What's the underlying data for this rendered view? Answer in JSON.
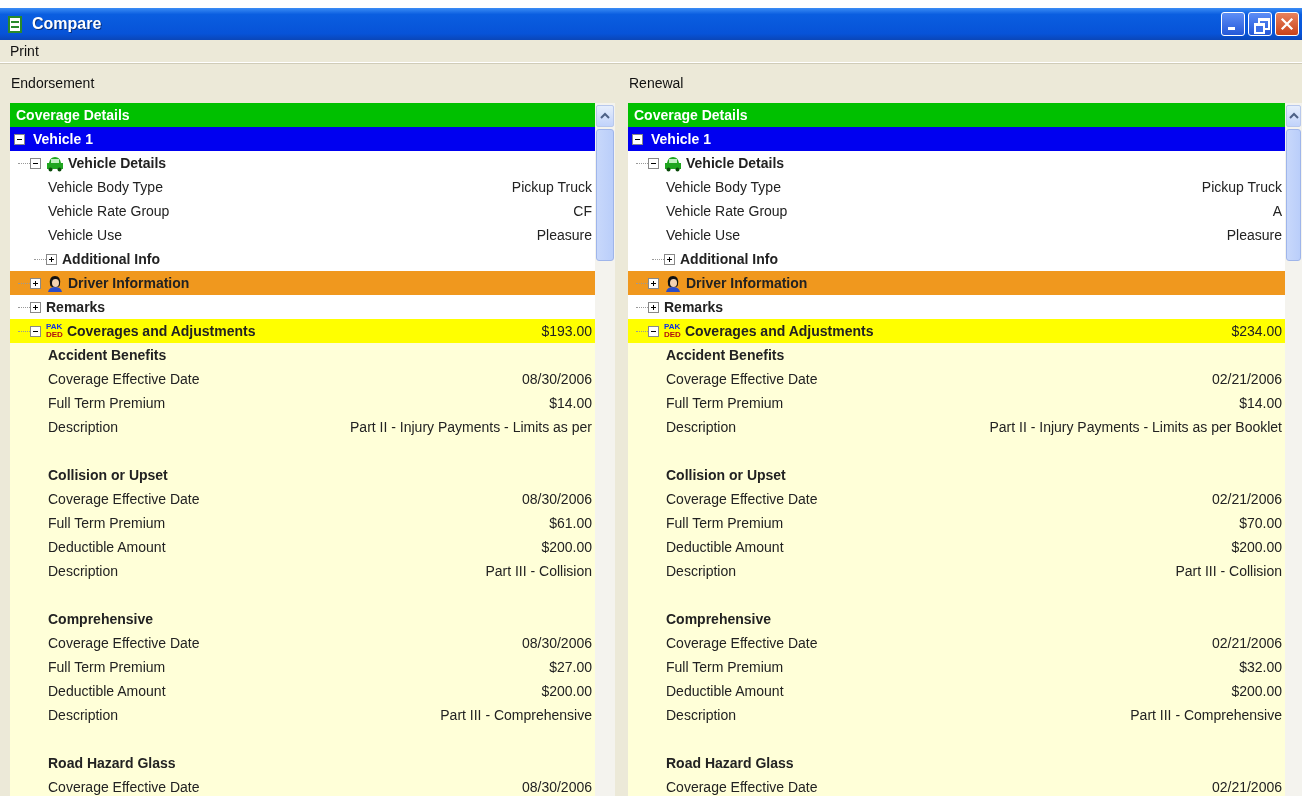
{
  "window": {
    "title": "Compare"
  },
  "menu": [
    {
      "label": "Print"
    }
  ],
  "panels": [
    {
      "label": "Endorsement",
      "header": "Coverage Details",
      "vehicle": {
        "label": "Vehicle 1",
        "expanded": true
      },
      "nodes": [
        {
          "kind": "details",
          "label": "Vehicle Details",
          "expanded": true,
          "fields": [
            {
              "label": "Vehicle Body Type",
              "value": "Pickup Truck"
            },
            {
              "label": "Vehicle Rate Group",
              "value": "CF"
            },
            {
              "label": "Vehicle Use",
              "value": "Pleasure"
            }
          ],
          "children": [
            {
              "label": "Additional Info",
              "expanded": false
            }
          ]
        },
        {
          "kind": "driver",
          "label": "Driver Information",
          "expanded": false
        },
        {
          "kind": "plain",
          "label": "Remarks",
          "expanded": false
        },
        {
          "kind": "coverages",
          "label": "Coverages and Adjustments",
          "total": "$193.00",
          "expanded": true,
          "badge_top": "PAK",
          "badge_bottom": "DED",
          "groups": [
            {
              "title": "Accident Benefits",
              "fields": [
                {
                  "label": "Coverage Effective Date",
                  "value": "08/30/2006"
                },
                {
                  "label": "Full Term Premium",
                  "value": "$14.00"
                },
                {
                  "label": "Description",
                  "value": "Part II - Injury Payments - Limits as per"
                }
              ]
            },
            {
              "title": "Collision or Upset",
              "fields": [
                {
                  "label": "Coverage Effective Date",
                  "value": "08/30/2006"
                },
                {
                  "label": "Full Term Premium",
                  "value": "$61.00"
                },
                {
                  "label": "Deductible Amount",
                  "value": "$200.00"
                },
                {
                  "label": "Description",
                  "value": "Part III - Collision"
                }
              ]
            },
            {
              "title": "Comprehensive",
              "fields": [
                {
                  "label": "Coverage Effective Date",
                  "value": "08/30/2006"
                },
                {
                  "label": "Full Term Premium",
                  "value": "$27.00"
                },
                {
                  "label": "Deductible Amount",
                  "value": "$200.00"
                },
                {
                  "label": "Description",
                  "value": "Part III - Comprehensive"
                }
              ]
            },
            {
              "title": "Road Hazard Glass",
              "fields": [
                {
                  "label": "Coverage Effective Date",
                  "value": "08/30/2006"
                }
              ]
            }
          ]
        }
      ]
    },
    {
      "label": "Renewal",
      "header": "Coverage Details",
      "vehicle": {
        "label": "Vehicle 1",
        "expanded": true
      },
      "nodes": [
        {
          "kind": "details",
          "label": "Vehicle Details",
          "expanded": true,
          "fields": [
            {
              "label": "Vehicle Body Type",
              "value": "Pickup Truck"
            },
            {
              "label": "Vehicle Rate Group",
              "value": "A"
            },
            {
              "label": "Vehicle Use",
              "value": "Pleasure"
            }
          ],
          "children": [
            {
              "label": "Additional Info",
              "expanded": false
            }
          ]
        },
        {
          "kind": "driver",
          "label": "Driver Information",
          "expanded": false
        },
        {
          "kind": "plain",
          "label": "Remarks",
          "expanded": false
        },
        {
          "kind": "coverages",
          "label": "Coverages and Adjustments",
          "total": "$234.00",
          "expanded": true,
          "badge_top": "PAK",
          "badge_bottom": "DED",
          "groups": [
            {
              "title": "Accident Benefits",
              "fields": [
                {
                  "label": "Coverage Effective Date",
                  "value": "02/21/2006"
                },
                {
                  "label": "Full Term Premium",
                  "value": "$14.00"
                },
                {
                  "label": "Description",
                  "value": "Part II - Injury Payments - Limits as per Booklet"
                }
              ]
            },
            {
              "title": "Collision or Upset",
              "fields": [
                {
                  "label": "Coverage Effective Date",
                  "value": "02/21/2006"
                },
                {
                  "label": "Full Term Premium",
                  "value": "$70.00"
                },
                {
                  "label": "Deductible Amount",
                  "value": "$200.00"
                },
                {
                  "label": "Description",
                  "value": "Part III - Collision"
                }
              ]
            },
            {
              "title": "Comprehensive",
              "fields": [
                {
                  "label": "Coverage Effective Date",
                  "value": "02/21/2006"
                },
                {
                  "label": "Full Term Premium",
                  "value": "$32.00"
                },
                {
                  "label": "Deductible Amount",
                  "value": "$200.00"
                },
                {
                  "label": "Description",
                  "value": "Part III - Comprehensive"
                }
              ]
            },
            {
              "title": "Road Hazard Glass",
              "fields": [
                {
                  "label": "Coverage Effective Date",
                  "value": "02/21/2006"
                }
              ]
            }
          ]
        }
      ]
    }
  ]
}
